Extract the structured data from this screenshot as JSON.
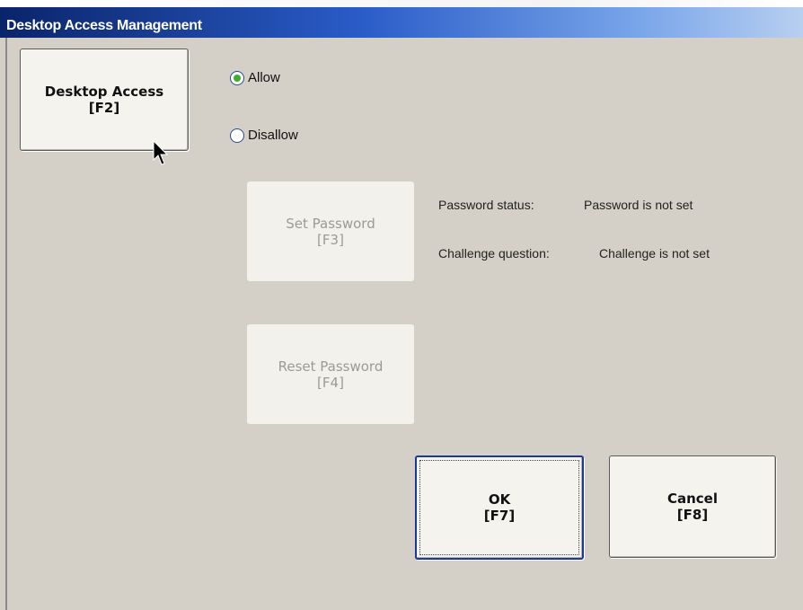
{
  "window": {
    "title": "Desktop Access Management"
  },
  "desktop_access": {
    "button_line1": "Desktop Access",
    "button_line2": "[F2]"
  },
  "access_options": [
    {
      "label": "Allow",
      "selected": true
    },
    {
      "label": "Disallow",
      "selected": false
    }
  ],
  "password": {
    "set_line1": "Set Password",
    "set_line2": "[F3]",
    "reset_line1": "Reset Password",
    "reset_line2": "[F4]",
    "status_label": "Password status:",
    "status_value": "Password is not set",
    "challenge_label": "Challenge question:",
    "challenge_value": "Challenge is not set"
  },
  "dialog_buttons": {
    "ok_line1": "OK",
    "ok_line2": "[F7]",
    "cancel_line1": "Cancel",
    "cancel_line2": "[F8]"
  },
  "colors": {
    "titlebar": "#0a246a",
    "radio_selected": "#3fae2a",
    "face": "#d4d0c8"
  },
  "icons": {
    "cursor": "arrow-cursor-icon"
  }
}
